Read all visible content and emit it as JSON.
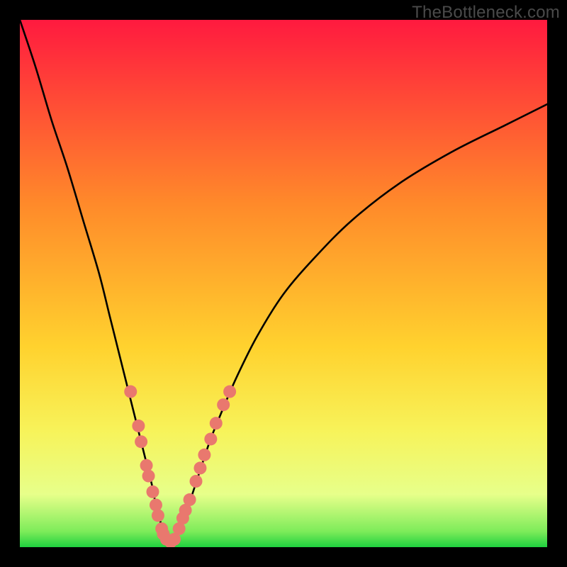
{
  "watermark": "TheBottleneck.com",
  "chart_data": {
    "type": "line",
    "title": "",
    "xlabel": "",
    "ylabel": "",
    "xlim": [
      0,
      100
    ],
    "ylim": [
      0,
      100
    ],
    "grid": false,
    "legend": false,
    "background": {
      "type": "vertical-gradient",
      "stops": [
        {
          "offset": 0,
          "color": "#ff1a3f"
        },
        {
          "offset": 35,
          "color": "#ff8a2a"
        },
        {
          "offset": 62,
          "color": "#ffd22e"
        },
        {
          "offset": 78,
          "color": "#f7f35a"
        },
        {
          "offset": 90,
          "color": "#e7ff8a"
        },
        {
          "offset": 97,
          "color": "#7eec5a"
        },
        {
          "offset": 100,
          "color": "#1fd13f"
        }
      ]
    },
    "series": [
      {
        "name": "left-curve",
        "type": "line",
        "color": "#000000",
        "x": [
          0,
          3,
          6,
          9,
          12,
          15,
          17,
          19,
          21,
          22.5,
          24,
          25,
          25.8,
          26.5,
          27,
          27.8,
          28.6
        ],
        "y": [
          100,
          91,
          81,
          72,
          62,
          52,
          44,
          36,
          28,
          22,
          16,
          12,
          8,
          5.5,
          3.5,
          1.8,
          0
        ]
      },
      {
        "name": "right-curve",
        "type": "line",
        "color": "#000000",
        "x": [
          28.6,
          30,
          32,
          34,
          36,
          38,
          41,
          45,
          50,
          56,
          63,
          72,
          82,
          92,
          100
        ],
        "y": [
          0,
          3,
          8,
          14,
          20,
          25,
          32,
          40,
          48,
          55,
          62,
          69,
          75,
          80,
          84
        ]
      }
    ],
    "scatter": {
      "name": "dots",
      "type": "scatter",
      "color": "#e9786e",
      "radius_px": 9,
      "points": [
        {
          "x": 21.0,
          "y": 29.5
        },
        {
          "x": 22.5,
          "y": 23.0
        },
        {
          "x": 23.0,
          "y": 20.0
        },
        {
          "x": 24.0,
          "y": 15.5
        },
        {
          "x": 24.4,
          "y": 13.5
        },
        {
          "x": 25.2,
          "y": 10.5
        },
        {
          "x": 25.8,
          "y": 8.0
        },
        {
          "x": 26.2,
          "y": 6.0
        },
        {
          "x": 26.9,
          "y": 3.5
        },
        {
          "x": 27.2,
          "y": 2.5
        },
        {
          "x": 27.8,
          "y": 1.5
        },
        {
          "x": 28.6,
          "y": 1.0
        },
        {
          "x": 29.3,
          "y": 1.5
        },
        {
          "x": 30.2,
          "y": 3.5
        },
        {
          "x": 30.9,
          "y": 5.5
        },
        {
          "x": 31.4,
          "y": 7.0
        },
        {
          "x": 32.2,
          "y": 9.0
        },
        {
          "x": 33.4,
          "y": 12.5
        },
        {
          "x": 34.2,
          "y": 15.0
        },
        {
          "x": 35.0,
          "y": 17.5
        },
        {
          "x": 36.2,
          "y": 20.5
        },
        {
          "x": 37.2,
          "y": 23.5
        },
        {
          "x": 38.6,
          "y": 27.0
        },
        {
          "x": 39.8,
          "y": 29.5
        }
      ]
    }
  }
}
